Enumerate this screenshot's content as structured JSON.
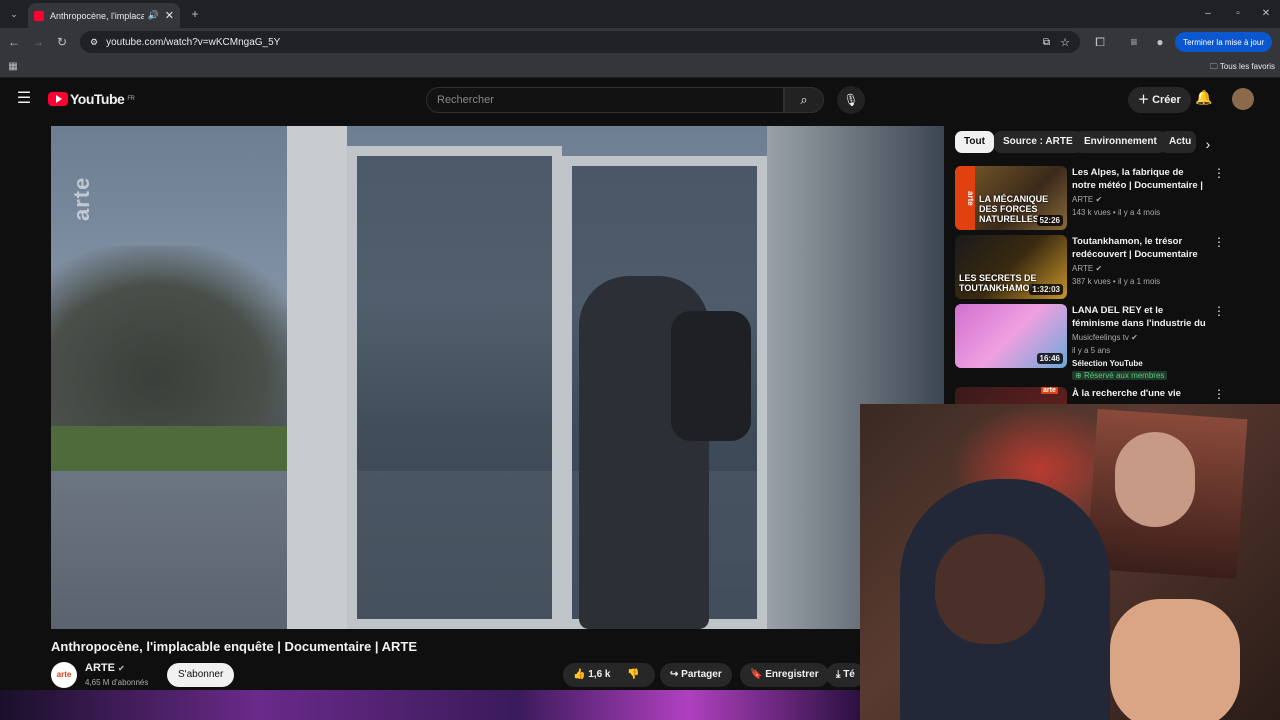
{
  "browser": {
    "tab_title": "Anthropocène, l'implacable",
    "url": "youtube.com/watch?v=wKCMngaG_5Y",
    "update_button": "Terminer la mise à jour",
    "bookmarks_label": "Tous les favoris"
  },
  "youtube": {
    "logo_text": "YouTube",
    "logo_region": "FR",
    "search_placeholder": "Rechercher",
    "create_label": "Créer"
  },
  "video": {
    "watermark": "arte",
    "title": "Anthropocène, l'implacable enquête | Documentaire | ARTE",
    "channel": "ARTE",
    "channel_avatar_text": "arte",
    "subscribers": "4,65 M d'abonnés",
    "subscribe_label": "S'abonner",
    "likes": "1,6 k",
    "share_label": "Partager",
    "save_label": "Enregistrer",
    "download_partial": "Té"
  },
  "chips": [
    {
      "label": "Tout",
      "active": true
    },
    {
      "label": "Source : ARTE"
    },
    {
      "label": "Environnement"
    },
    {
      "label": "Actu"
    }
  ],
  "recommendations": [
    {
      "title": "Les Alpes, la fabrique de notre météo | Documentaire | ARTE",
      "channel": "ARTE",
      "meta": "143 k vues • il y a 4 mois",
      "duration": "52:26",
      "thumb_caption": "LA MÉCANIQUE DES FORCES NATURELLES",
      "thumb_logo": "arte"
    },
    {
      "title": "Toutankhamon, le trésor redécouvert | Documentaire ...",
      "channel": "ARTE",
      "meta": "387 k vues • il y a 1 mois",
      "duration": "1:32:03",
      "thumb_caption": "LES SECRETS DE TOUTANKHAMON"
    },
    {
      "title": "LANA DEL REY et le féminisme dans l'industrie du disque.",
      "channel": "Musicfeelings tv",
      "meta": "il y a 5 ans",
      "badge": "Sélection YouTube",
      "members": "Réservé aux membres",
      "duration": "16:46"
    },
    {
      "title": "À la recherche d'une vie",
      "thumb_logo": "arte"
    }
  ]
}
